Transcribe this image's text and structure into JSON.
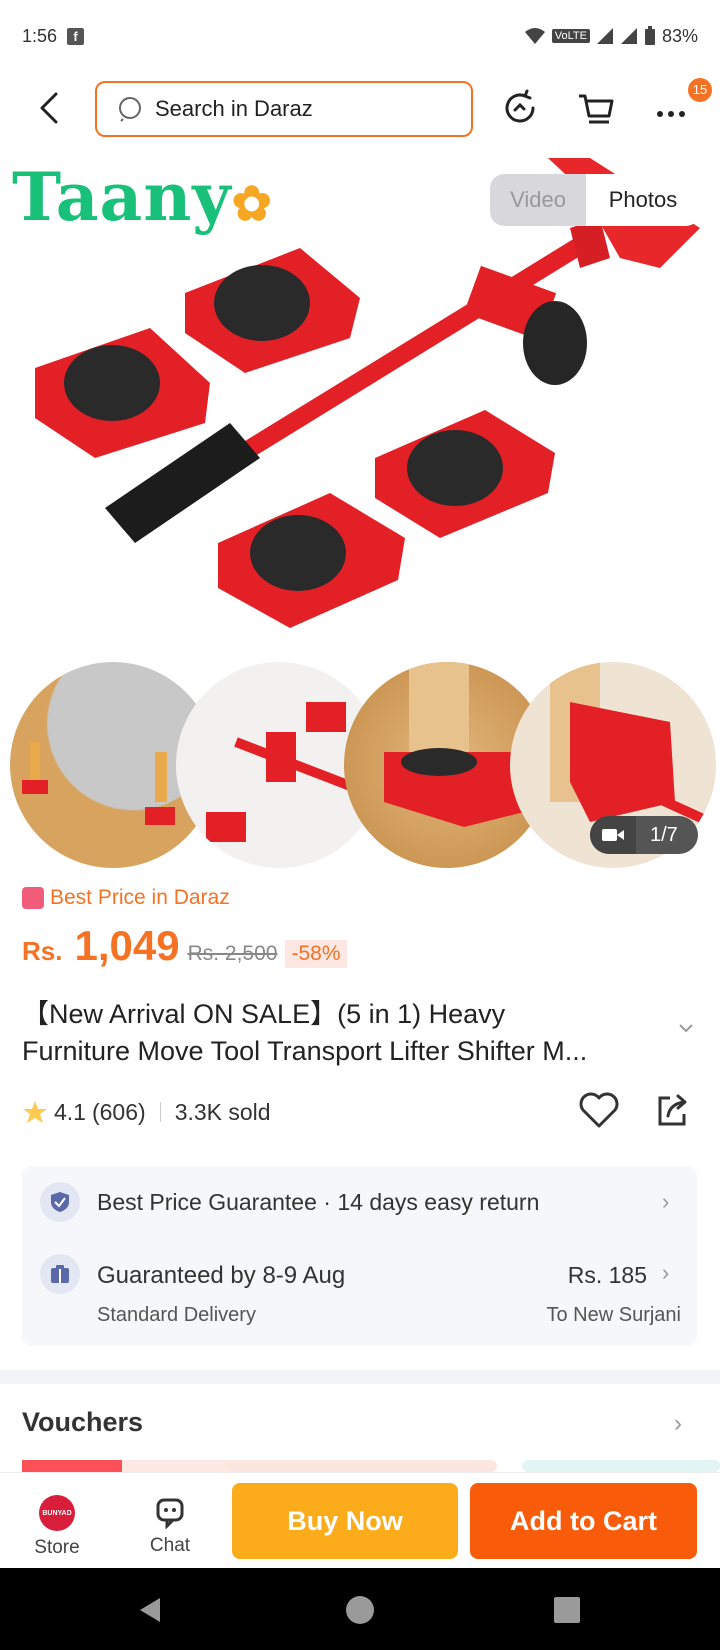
{
  "status_bar": {
    "time": "1:56",
    "network": "VoLTE",
    "battery": "83%"
  },
  "search": {
    "placeholder": "Search in Daraz"
  },
  "cart_badge": "15",
  "brand_logo": "Taany",
  "media_toggle": {
    "video": "Video",
    "photos": "Photos"
  },
  "gallery": {
    "counter": "1/7"
  },
  "best_price_label": "Best Price in Daraz",
  "price": {
    "currency": "Rs.",
    "current": "1,049",
    "original": "Rs. 2,500",
    "discount": "-58%"
  },
  "product": {
    "title_line1": "【New Arrival ON SALE】(5 in 1) Heavy",
    "title_line2": "Furniture Move Tool Transport Lifter Shifter M..."
  },
  "rating": {
    "score": "4.1",
    "count": "(606)",
    "sold": "3.3K sold"
  },
  "services": {
    "guarantee": "Best Price Guarantee",
    "return": "14 days easy return",
    "delivery_title": "Guaranteed by 8-9 Aug",
    "delivery_type": "Standard Delivery",
    "fee": "Rs. 185",
    "destination": "To New Surjani"
  },
  "vouchers": {
    "title": "Vouchers"
  },
  "bottom_bar": {
    "store": "Store",
    "store_logo": "BUNYAD",
    "chat": "Chat",
    "buy_now": "Buy Now",
    "add_to_cart": "Add to Cart"
  },
  "colors": {
    "accent": "#f57224",
    "buy_now": "#fcab1b",
    "add_to_cart": "#f85c0a",
    "brand_green": "#18c07a"
  }
}
